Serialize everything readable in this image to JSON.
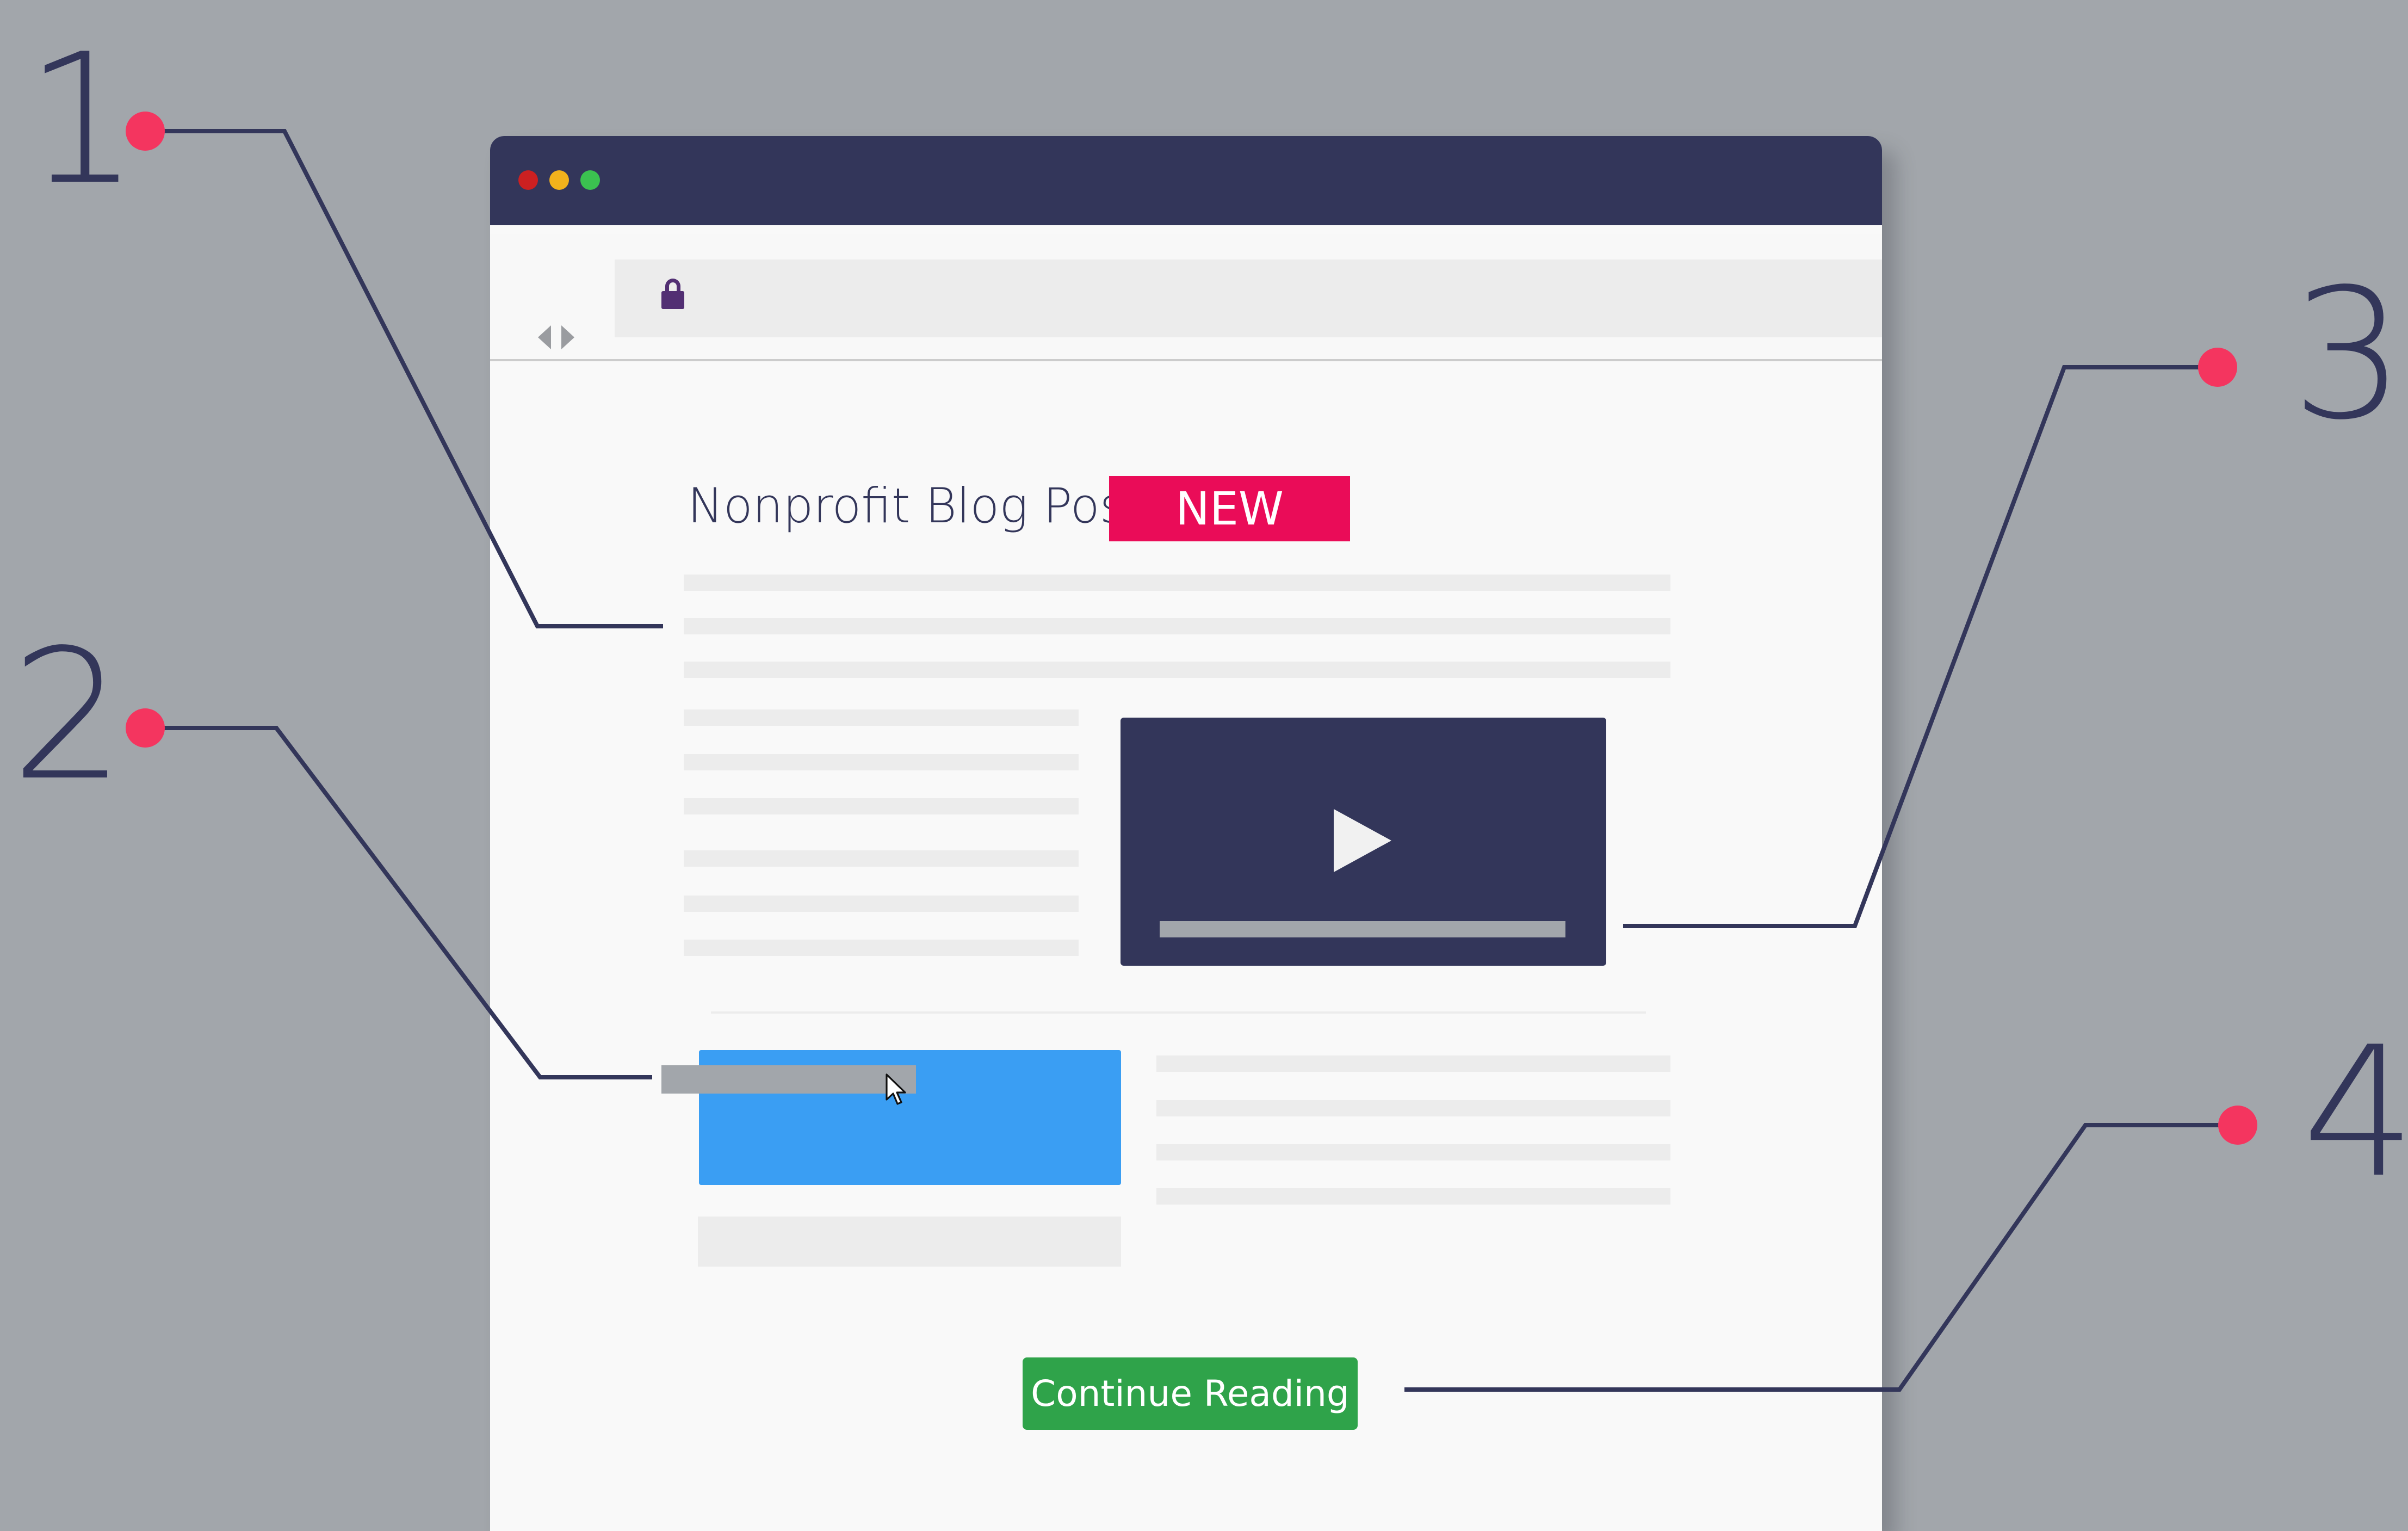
{
  "callouts": [
    "1",
    "2",
    "3",
    "4"
  ],
  "browser": {
    "traffic_lights": [
      "#cc2021",
      "#f2b21c",
      "#3bc150"
    ],
    "nav": {
      "back_icon": "chevron-left-icon",
      "forward_icon": "chevron-right-icon",
      "lock_icon": "lock-icon"
    }
  },
  "post": {
    "title": "Nonprofit Blog Post",
    "badge": "NEW",
    "video": {
      "icon": "play-icon"
    },
    "cta_button": {
      "cursor_icon": "mouse-pointer-icon"
    },
    "continue_label": "Continue Reading"
  },
  "colors": {
    "background": "#a2a6ab",
    "navy": "#33365a",
    "badge": "#ea0c58",
    "cta": "#3a9ef3",
    "continue": "#2fa34a",
    "dot": "#f4355f"
  }
}
